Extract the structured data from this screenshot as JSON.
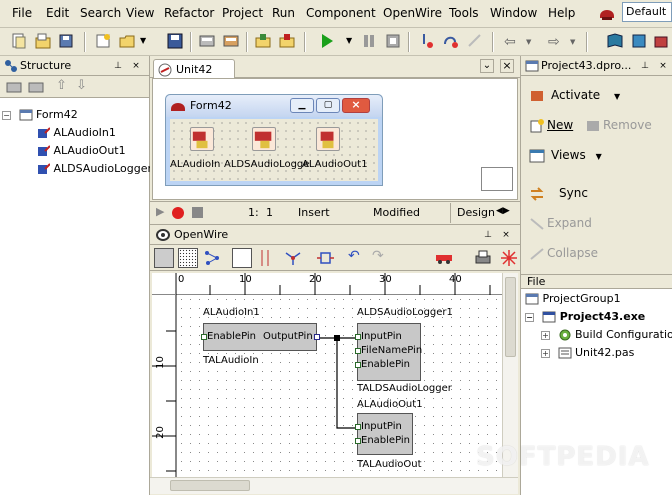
{
  "menu": [
    "File",
    "Edit",
    "Search",
    "View",
    "Refactor",
    "Project",
    "Run",
    "Component",
    "OpenWire",
    "Tools",
    "Window",
    "Help"
  ],
  "layout_combo": "Default",
  "structure": {
    "title": "Structure",
    "items": [
      "Form42",
      "ALAudioIn1",
      "ALAudioOut1",
      "ALDSAudioLogger1"
    ]
  },
  "designer": {
    "tab": "Unit42",
    "form_title": "Form42",
    "components": [
      "ALAudioIn",
      "ALDSAudioLogge",
      "ALAudioOut1"
    ],
    "status": {
      "line": "1:",
      "col": "1",
      "mode": "Insert",
      "modified": "Modified"
    },
    "design_tab": "Design"
  },
  "openwire": {
    "title": "OpenWire",
    "ruler_h": [
      "0",
      "10",
      "20",
      "30",
      "40"
    ],
    "ruler_v": [
      "10",
      "20"
    ],
    "nodes": {
      "in_name": "ALAudioIn1",
      "in_type": "TALAudioIn",
      "in_pin_left": "EnablePin",
      "in_pin_right": "OutputPin",
      "logger_name": "ALDSAudioLogger1",
      "logger_type": "TALDSAudioLogger",
      "logger_pins": [
        "InputPin",
        "FileNamePin",
        "EnablePin"
      ],
      "out_name": "ALAudioOut1",
      "out_type": "TALAudioOut",
      "out_pins": [
        "InputPin",
        "EnablePin"
      ]
    }
  },
  "project": {
    "title": "Project43.dpro...",
    "actions": [
      "Activate",
      "New",
      "Remove",
      "Views",
      "Sync",
      "Expand",
      "Collapse"
    ],
    "file_header": "File",
    "tree": [
      "ProjectGroup1",
      "Project43.exe",
      "Build Configurations",
      "Unit42.pas"
    ]
  },
  "watermark": "SOFTPEDIA"
}
